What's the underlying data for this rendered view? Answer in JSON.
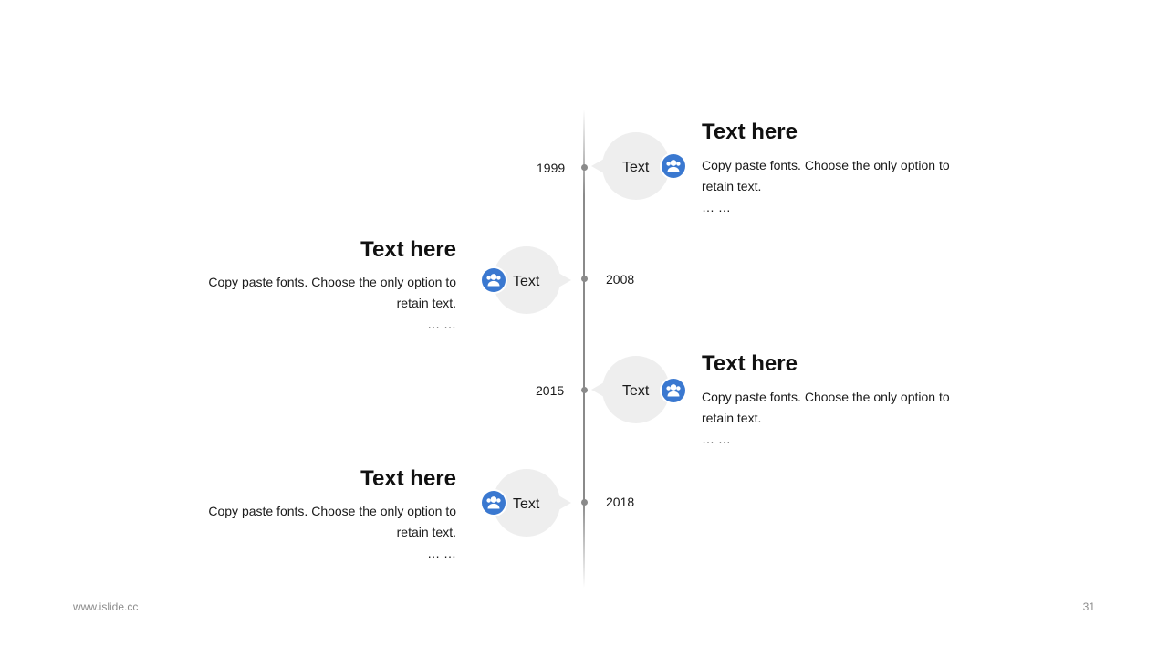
{
  "colors": {
    "accent": "#3a78d0",
    "bubble": "#eeeeee",
    "axis": "#8a8a8a",
    "rule": "#a8a8a8"
  },
  "timeline": [
    {
      "year": "1999",
      "bubble_label": "Text",
      "title": "Text here",
      "desc": "Copy paste fonts. Choose the only option to retain text.",
      "ellipsis": "… …",
      "icon": "user-group-icon"
    },
    {
      "year": "2008",
      "bubble_label": "Text",
      "title": "Text here",
      "desc": "Copy paste fonts. Choose the only option to retain text.",
      "ellipsis": "… …",
      "icon": "user-group-icon"
    },
    {
      "year": "2015",
      "bubble_label": "Text",
      "title": "Text here",
      "desc": "Copy paste fonts. Choose the only option to retain text.",
      "ellipsis": "… …",
      "icon": "user-group-icon"
    },
    {
      "year": "2018",
      "bubble_label": "Text",
      "title": "Text here",
      "desc": "Copy paste fonts. Choose the only option to retain text.",
      "ellipsis": "… …",
      "icon": "user-group-icon"
    }
  ],
  "footer": {
    "website": "www.islide.cc",
    "page_number": "31"
  }
}
